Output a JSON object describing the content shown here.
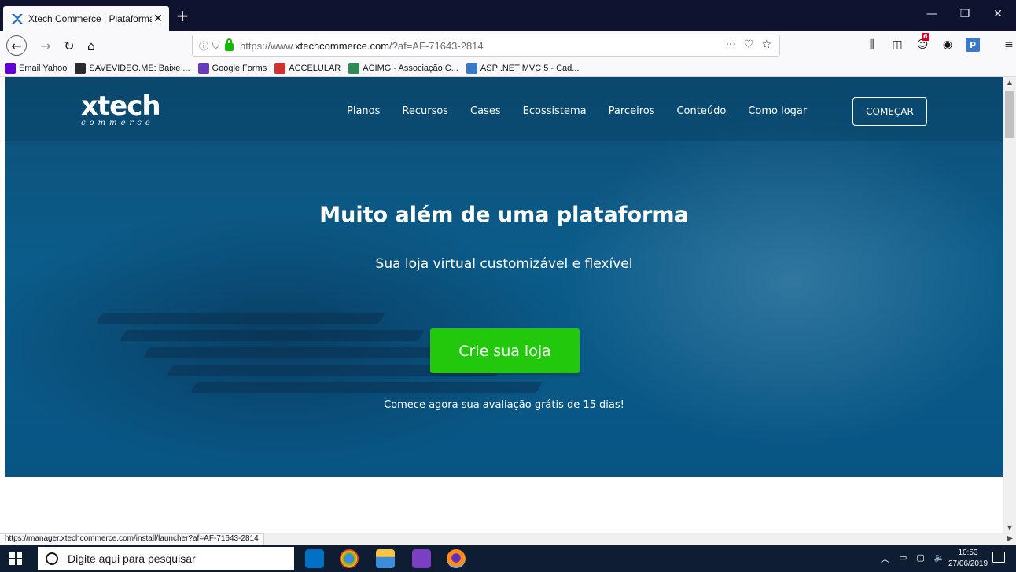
{
  "browser": {
    "tab_title": "Xtech Commerce | Plataforma",
    "url_prefix": "https://www.",
    "url_domain": "xtechcommerce.com",
    "url_suffix": "/?af=AF-71643-2814",
    "notification_badge": "6",
    "status_url": "https://manager.xtechcommerce.com/install/launcher?af=AF-71643-2814"
  },
  "bookmarks": [
    {
      "label": "Email Yahoo",
      "icon": "yahoo-icon",
      "color": "#5f01d1"
    },
    {
      "label": "SAVEVIDEO.ME: Baixe ...",
      "icon": "globe-icon",
      "color": "#2a2a2e"
    },
    {
      "label": "Google Forms",
      "icon": "google-forms-icon",
      "color": "#673ab7"
    },
    {
      "label": "ACCELULAR",
      "icon": "accelular-icon",
      "color": "#d03030"
    },
    {
      "label": "ACIMG - Associação C...",
      "icon": "acimg-icon",
      "color": "#2e8b57"
    },
    {
      "label": "ASP .NET MVC 5 - Cad...",
      "icon": "macoratti-icon",
      "color": "#3c78c8"
    }
  ],
  "site": {
    "logo_main": "xtech",
    "logo_sub": "commerce",
    "menu": [
      "Planos",
      "Recursos",
      "Cases",
      "Ecossistema",
      "Parceiros",
      "Conteúdo",
      "Como logar"
    ],
    "header_cta": "COMEÇAR",
    "hero_title": "Muito além de uma plataforma",
    "hero_subtitle": "Sua loja virtual customizável e flexível",
    "hero_cta": "Crie sua loja",
    "hero_note": "Comece agora sua avaliação grátis de 15 dias!"
  },
  "taskbar": {
    "search_placeholder": "Digite aqui para pesquisar",
    "time": "10:53",
    "date": "27/06/2019"
  },
  "colors": {
    "hero_blue": "#0b5c8a",
    "cta_green": "#22c80c",
    "titlebar": "#0f1330"
  }
}
